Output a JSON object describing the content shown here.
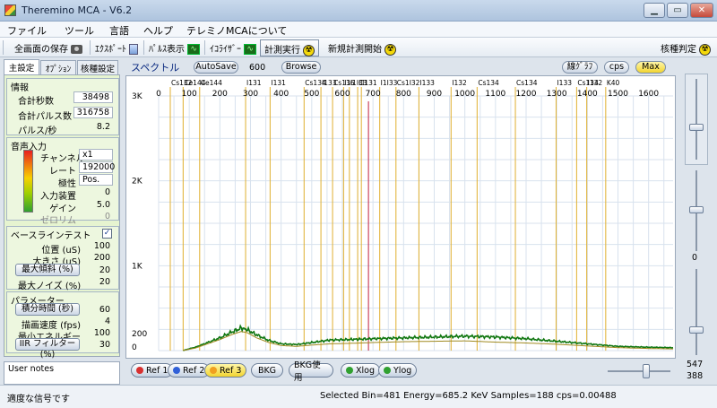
{
  "window": {
    "title": "Theremino MCA - V6.2"
  },
  "menu": [
    "ファイル",
    "ツール",
    "言語",
    "ヘルプ",
    "テレミノMCAについて"
  ],
  "toolbar": {
    "save_screen": "全画面の保存",
    "export": "ｴｸｽﾎﾟｰﾄ",
    "pulse_display": "ﾊﾟﾙｽ表示",
    "equalizer": "ｲｺﾗｲｻﾞｰ",
    "run_measure": "計測実行",
    "new_measure": "新規計測開始",
    "nuclide": "核種判定"
  },
  "tabs": [
    "主設定",
    "ｵﾌﾟｼｮﾝ",
    "核種設定"
  ],
  "info": {
    "title": "情報",
    "total_seconds_label": "合計秒数",
    "total_seconds": "38498",
    "total_pulses_label": "合計パルス数",
    "total_pulses": "316758",
    "pulse_rate_label": "パルス/秒",
    "pulse_rate": "8.2"
  },
  "audio": {
    "title": "音声入力",
    "channel_label": "チャンネル",
    "channel": "x1",
    "rate_label": "レート",
    "rate": "192000",
    "polarity_label": "極性",
    "polarity": "Pos.",
    "input_device_label": "入力装置",
    "input_device": "0",
    "gain_label": "ゲイン",
    "gain": "5.0",
    "zero_label": "ゼロリム",
    "zero": "0"
  },
  "baseline": {
    "title": "ベースラインテスト",
    "checkbox": "✓",
    "position_label": "位置 (uS)",
    "position": "100",
    "size_label": "大きさ (uS)",
    "size": "200",
    "max_slope_label": "最大傾斜 (%)",
    "max_slope": "20",
    "max_noise_label": "最大ノイズ (%)",
    "max_noise": "20"
  },
  "params": {
    "title": "パラメーター",
    "integration_label": "積分時間 (秒)",
    "integration": "60",
    "draw_speed_label": "描画速度 (fps)",
    "draw_speed": "4",
    "min_energy_label": "最小エネルギー",
    "min_energy": "100",
    "iir_label": "IIR フィルター (%)",
    "iir": "30"
  },
  "user_notes": "User notes",
  "spectrum_header": {
    "title": "スペクトル",
    "autosave": "AutoSave",
    "autosave_value": "600",
    "browse": "Browse",
    "line_graph": "線ｸﾞﾗﾌ",
    "cps": "cps",
    "max": "Max",
    "max_value": "3000"
  },
  "bottom_buttons": {
    "ref1": "Ref 1",
    "ref2": "Ref 2",
    "ref3": "Ref 3",
    "bkg": "BKG",
    "bkg_use": "BKG使用",
    "xlog": "Xlog",
    "ylog": "Ylog"
  },
  "right_panel": {
    "mid_value": "0",
    "val1": "547",
    "val2": "388"
  },
  "status": {
    "left": "適度な信号です",
    "info": "Selected Bin=481  Energy=685.2 KeV  Samples=188  cps=0.00488"
  },
  "chart_data": {
    "type": "line",
    "x_ticks": [
      0,
      100,
      200,
      300,
      400,
      500,
      600,
      700,
      800,
      900,
      1000,
      1100,
      1200,
      1300,
      1400,
      1500,
      1600
    ],
    "y_ticks": [
      {
        "value": 0,
        "label": "0"
      },
      {
        "value": 200,
        "label": "200"
      },
      {
        "value": 1000,
        "label": "1K"
      },
      {
        "value": 2000,
        "label": "2K"
      },
      {
        "value": 3000,
        "label": "3K"
      }
    ],
    "xlim": [
      0,
      1680
    ],
    "ylim": [
      0,
      3000
    ],
    "grid": true,
    "markers": [
      {
        "label": "Cs132",
        "x": 38
      },
      {
        "label": "Ce144",
        "x": 80
      },
      {
        "label": "Ce144",
        "x": 134
      },
      {
        "label": "I131",
        "x": 284
      },
      {
        "label": "I131",
        "x": 364
      },
      {
        "label": "Cs134",
        "x": 475
      },
      {
        "label": "I133",
        "x": 530
      },
      {
        "label": "Cs136",
        "x": 568
      },
      {
        "label": "I1",
        "x": 604
      },
      {
        "label": "I1I33",
        "x": 623
      },
      {
        "label": "C",
        "x": 650
      },
      {
        "label": "I131",
        "x": 662
      },
      {
        "label": "I1I33",
        "x": 722
      },
      {
        "label": "Cs1I32",
        "x": 775
      },
      {
        "label": "I133",
        "x": 850
      },
      {
        "label": "I132",
        "x": 955
      },
      {
        "label": "Cs134",
        "x": 1040
      },
      {
        "label": "Cs134",
        "x": 1165
      },
      {
        "label": "I133",
        "x": 1298
      },
      {
        "label": "Cs134",
        "x": 1365
      },
      {
        "label": "I132",
        "x": 1398
      },
      {
        "label": "K40",
        "x": 1460
      }
    ],
    "selected_bin": 481,
    "selected_energy": 685.2,
    "series": [
      {
        "color": "#117711",
        "x": [
          80,
          120,
          160,
          200,
          240,
          270,
          290,
          320,
          360,
          400,
          450,
          500,
          560,
          620,
          700,
          800,
          900,
          1000,
          1100,
          1200,
          1300,
          1400,
          1500,
          1600,
          1680
        ],
        "values": [
          2,
          40,
          95,
          150,
          220,
          265,
          245,
          185,
          120,
          80,
          72,
          95,
          125,
          130,
          140,
          150,
          160,
          170,
          160,
          140,
          110,
          80,
          50,
          40,
          35
        ]
      },
      {
        "color": "#a08a20",
        "x": [
          80,
          120,
          160,
          200,
          240,
          270,
          290,
          320,
          360,
          400,
          450,
          500,
          560,
          620,
          700,
          800,
          900,
          1000,
          1100,
          1200,
          1300,
          1400,
          1500,
          1600,
          1680
        ],
        "values": [
          2,
          30,
          80,
          130,
          190,
          225,
          210,
          150,
          95,
          60,
          50,
          65,
          80,
          85,
          95,
          105,
          110,
          115,
          100,
          90,
          75,
          55,
          35,
          25,
          20
        ]
      }
    ]
  }
}
